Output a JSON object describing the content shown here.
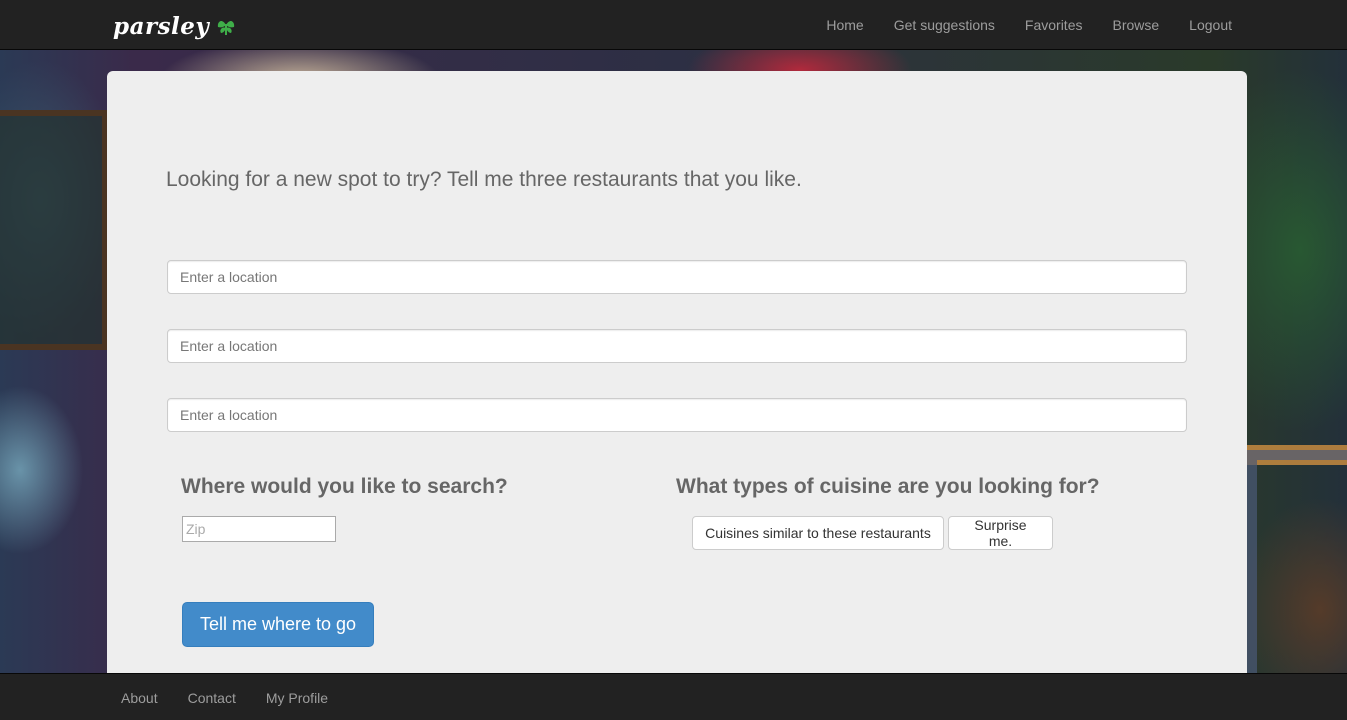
{
  "brand": {
    "name": "parsley",
    "icon": "leaf-icon",
    "icon_color": "#3fae49"
  },
  "nav": {
    "items": [
      {
        "label": "Home"
      },
      {
        "label": "Get suggestions"
      },
      {
        "label": "Favorites"
      },
      {
        "label": "Browse"
      },
      {
        "label": "Logout"
      }
    ]
  },
  "main": {
    "lead": "Looking for a new spot to try? Tell me three restaurants that you like.",
    "locations": [
      {
        "placeholder": "Enter a location",
        "value": ""
      },
      {
        "placeholder": "Enter a location",
        "value": ""
      },
      {
        "placeholder": "Enter a location",
        "value": ""
      }
    ],
    "search": {
      "title": "Where would you like to search?",
      "zip_placeholder": "Zip"
    },
    "cuisine": {
      "title": "What types of cuisine are you looking for?",
      "similar_label": "Cuisines similar to these restaurants",
      "surprise_label": "Surprise me."
    },
    "submit_label": "Tell me where to go"
  },
  "footer": {
    "items": [
      {
        "label": "About"
      },
      {
        "label": "Contact"
      },
      {
        "label": "My Profile"
      }
    ]
  },
  "colors": {
    "navbar": "#222222",
    "panel": "#eeeeee",
    "primary": "#428bca"
  }
}
